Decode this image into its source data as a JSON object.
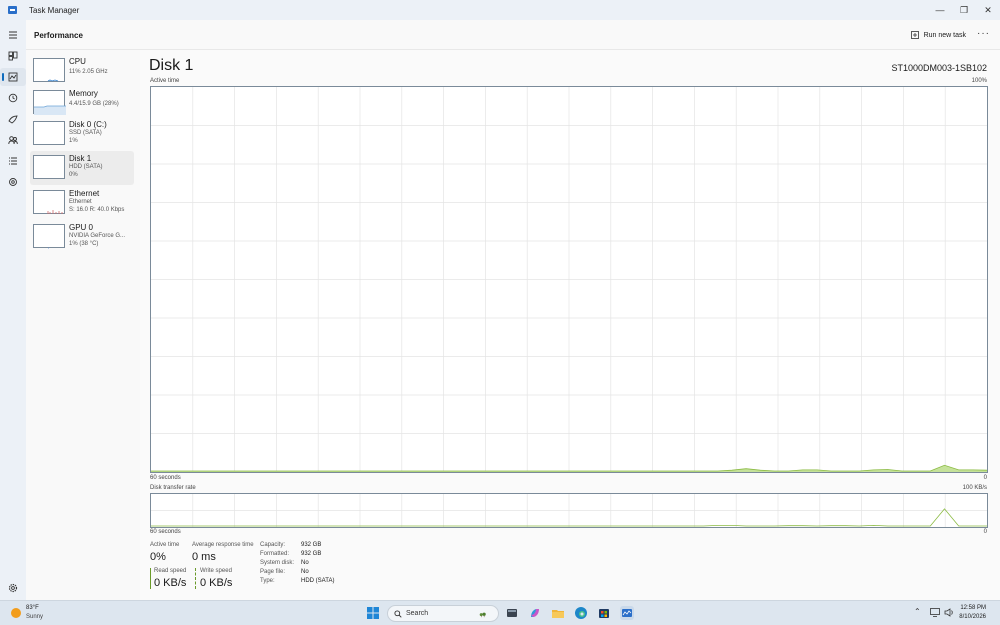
{
  "window": {
    "title": "Task Manager",
    "controls": [
      "minimize-icon",
      "maximize-icon",
      "close-icon"
    ]
  },
  "rail": {
    "items": [
      "hamburger-icon",
      "processes-icon",
      "performance-icon",
      "app-history-icon",
      "startup-apps-icon",
      "users-icon",
      "details-icon",
      "services-icon",
      "settings-icon"
    ],
    "active": "performance-icon"
  },
  "header": {
    "title": "Performance",
    "run_task_label": "Run new task",
    "more_label": "···"
  },
  "devices": [
    {
      "name": "CPU",
      "sub1": "11% 2.05 GHz",
      "sub2": ""
    },
    {
      "name": "Memory",
      "sub1": "4.4/15.9 GB (28%)",
      "sub2": ""
    },
    {
      "name": "Disk 0 (C:)",
      "sub1": "SSD (SATA)",
      "sub2": "1%"
    },
    {
      "name": "Disk 1",
      "sub1": "HDD (SATA)",
      "sub2": "0%"
    },
    {
      "name": "Ethernet",
      "sub1": "Ethernet",
      "sub2": "S: 16.0  R: 40.0 Kbps"
    },
    {
      "name": "GPU 0",
      "sub1": "NVIDIA GeForce G...",
      "sub2": "1% (38 °C)"
    }
  ],
  "selected_device": "Disk 1",
  "detail": {
    "title": "Disk 1",
    "model": "ST1000DM003-1SB102",
    "active_time_label": "Active time",
    "active_time_max": "100%",
    "graph1_left": "60 seconds",
    "graph1_right": "0",
    "transfer_label": "Disk transfer rate",
    "transfer_max": "100 KB/s",
    "graph2_left": "60 seconds",
    "graph2_right": "0"
  },
  "stats": {
    "active_time_label": "Active time",
    "active_time_value": "0%",
    "avg_response_label": "Average response time",
    "avg_response_value": "0 ms",
    "read_speed_label": "Read speed",
    "read_speed_value": "0 KB/s",
    "write_speed_label": "Write speed",
    "write_speed_value": "0 KB/s"
  },
  "properties": [
    {
      "key": "Capacity:",
      "value": "932 GB"
    },
    {
      "key": "Formatted:",
      "value": "932 GB"
    },
    {
      "key": "System disk:",
      "value": "No"
    },
    {
      "key": "Page file:",
      "value": "No"
    },
    {
      "key": "Type:",
      "value": "HDD (SATA)"
    }
  ],
  "graph_series": {
    "active_time_pct": [
      0,
      0,
      0,
      0,
      0,
      0,
      0,
      0,
      0,
      0,
      0,
      0,
      0,
      0,
      0,
      0,
      0,
      0,
      0,
      0,
      0,
      0,
      0,
      0,
      0,
      0,
      0,
      0,
      0,
      0,
      0,
      0,
      0,
      0,
      0,
      0,
      0,
      0,
      0,
      0,
      0,
      0.2,
      0.6,
      0.2,
      0,
      0,
      0.3,
      0.3,
      0,
      0,
      0,
      0.3,
      0.4,
      0,
      0,
      0,
      1.5,
      0.3,
      0.3,
      0.2
    ],
    "transfer_kbs": [
      0,
      0,
      0,
      0,
      0,
      0,
      0,
      0,
      0,
      0,
      0,
      0,
      0,
      0,
      0,
      0,
      0,
      0,
      0,
      0,
      0,
      0,
      0,
      0,
      0,
      0,
      0,
      0,
      0,
      0,
      0,
      0,
      0,
      0,
      0,
      0,
      0,
      0,
      0,
      0,
      2,
      2,
      0,
      0,
      0,
      1,
      1,
      0,
      1,
      1,
      0,
      2,
      0,
      0,
      0,
      0,
      55,
      0,
      0,
      0
    ]
  },
  "colors": {
    "graph_line": "#8bbb43",
    "graph_fill": "#c5e29a",
    "grid": "#e4e4e4",
    "border": "#7a8a99",
    "accent": "#0f6cbd"
  },
  "taskbar": {
    "weather_temp": "83°F",
    "weather_desc": "Sunny",
    "search_placeholder": "Search",
    "time": "12:58 PM",
    "date": "8/10/2026",
    "apps": [
      "start-icon",
      "search-icon",
      "tree-widget-icon",
      "file-explorer-icon",
      "copilot-icon",
      "edge-icon",
      "folder-icon",
      "store-icon",
      "task-manager-icon"
    ],
    "tray": [
      "chevron-up-icon",
      "network-icon",
      "volume-icon"
    ]
  }
}
